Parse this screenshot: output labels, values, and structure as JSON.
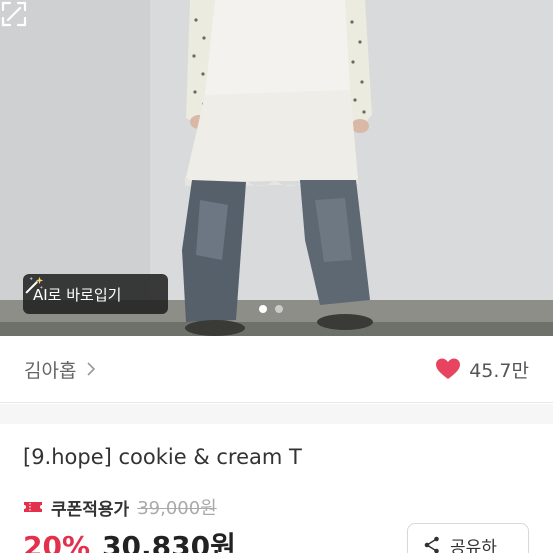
{
  "hero": {
    "ai_button_label": "AI로 바로입기",
    "slide_dots": 2,
    "active_slide": 1
  },
  "shop": {
    "name": "김아홉",
    "likes": "45.7만"
  },
  "product": {
    "title": "[9.hope] cookie & cream T",
    "coupon_label": "쿠폰적용가",
    "original_price": "39,000원",
    "discount": "20%",
    "price": "30,830원"
  },
  "actions": {
    "share_label": "공유하"
  },
  "colors": {
    "accent_red": "#e3304d",
    "heart": "#e7455f"
  },
  "icons": [
    "magic-wand-icon",
    "expand-icon",
    "chevron-right-icon",
    "heart-icon",
    "coupon-ticket-icon",
    "share-icon"
  ]
}
